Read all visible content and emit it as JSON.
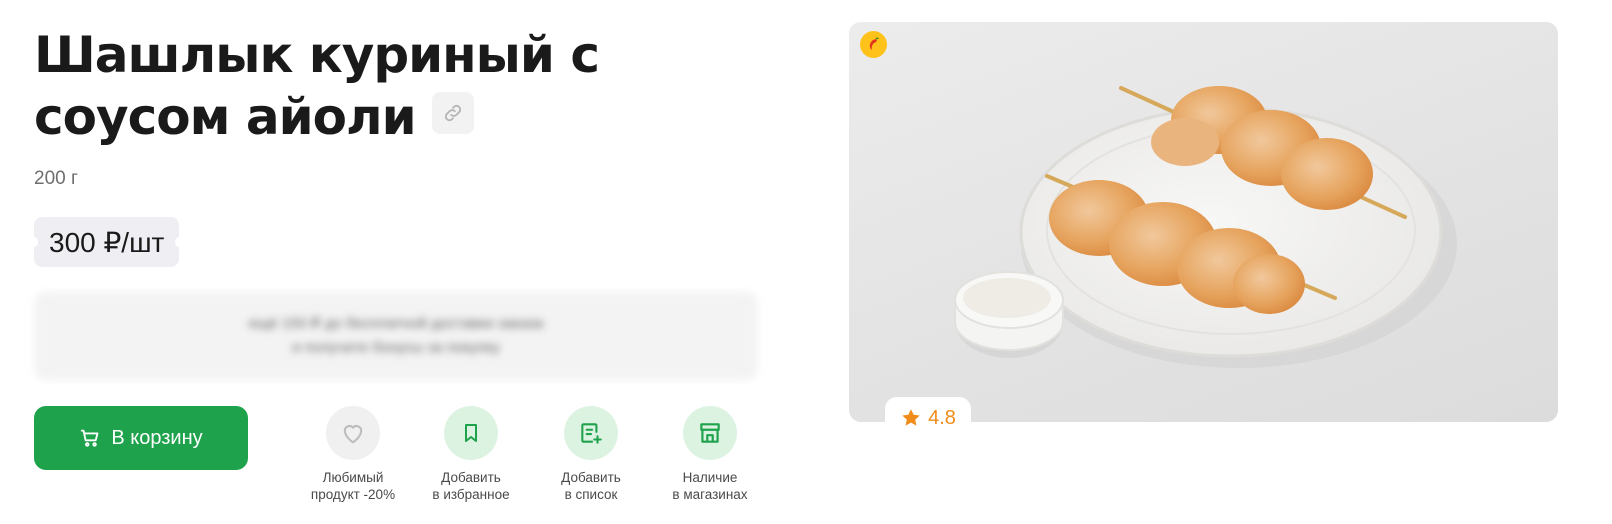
{
  "product": {
    "title": "Шашлык куриный с соусом айоли",
    "weight": "200 г",
    "price": "300 ₽/шт",
    "rating": "4.8"
  },
  "promo": {
    "line1": "ещё 150 ₽ до бесплатной доставки заказа",
    "line2": "и получите бонусы за покупку"
  },
  "cart_button": {
    "label": "В корзину"
  },
  "actions": [
    {
      "line1": "Любимый",
      "line2": "продукт -20%",
      "icon": "heart-icon"
    },
    {
      "line1": "Добавить",
      "line2": "в избранное",
      "icon": "bookmark-icon"
    },
    {
      "line1": "Добавить",
      "line2": "в список",
      "icon": "list-add-icon"
    },
    {
      "line1": "Наличие",
      "line2": "в магазинах",
      "icon": "store-icon"
    }
  ],
  "colors": {
    "brand_green": "#1ea24c",
    "action_bg_green": "#dcf3e2",
    "action_bg_gray": "#f0f0f0",
    "rating_orange": "#f08c1a",
    "hot_badge": "#ffc21a"
  }
}
